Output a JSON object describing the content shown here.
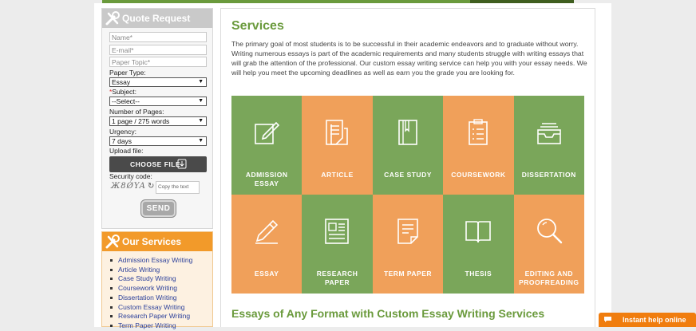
{
  "quote": {
    "title": "Quote Request",
    "name_ph": "Name*",
    "email_ph": "E-mail*",
    "topic_ph": "Paper Topic*",
    "paper_type_label": "Paper Type:",
    "paper_type_value": "Essay",
    "subject_label": "Subject:",
    "subject_value": "--Select--",
    "pages_label": "Number of Pages:",
    "pages_value": "1 page / 275 words",
    "urgency_label": "Urgency:",
    "urgency_value": "7 days",
    "upload_label": "Upload file:",
    "choose_label": "CHOOSE FILE",
    "security_label": "Security code:",
    "captcha_text": "Ж8ǾYA",
    "copy_ph": "Copy the text",
    "send_label": "SEND"
  },
  "our_services": {
    "title": "Our Services",
    "items": [
      "Admission Essay Writing",
      "Article Writing",
      "Case Study Writing",
      "Coursework Writing",
      "Dissertation Writing",
      "Custom Essay Writing",
      "Research Paper Writing",
      "Term Paper Writing"
    ]
  },
  "main": {
    "title": "Services",
    "intro": "The primary goal of most students is to be successful in their academic endeavors and to graduate without worry. Writing numerous essays is part of the academic requirements and many students struggle with writing essays that will grab the attention of the professional. Our custom essay writing service can help you with your essay needs. We will help you meet the upcoming deadlines as well as earn you the grade you are looking for.",
    "tiles": [
      {
        "label": "ADMISSION ESSAY",
        "icon": "edit-icon",
        "color": "#7aa65a"
      },
      {
        "label": "ARTICLE",
        "icon": "document-icon",
        "color": "#f0a05a"
      },
      {
        "label": "CASE STUDY",
        "icon": "book-icon",
        "color": "#7aa65a"
      },
      {
        "label": "COURSEWORK",
        "icon": "checklist-icon",
        "color": "#f0a05a"
      },
      {
        "label": "DISSERTATION",
        "icon": "tray-icon",
        "color": "#7aa65a"
      },
      {
        "label": "ESSAY",
        "icon": "pencil-icon",
        "color": "#f0a05a"
      },
      {
        "label": "RESEARCH PAPER",
        "icon": "newspaper-icon",
        "color": "#7aa65a"
      },
      {
        "label": "TERM PAPER",
        "icon": "page-icon",
        "color": "#f0a05a"
      },
      {
        "label": "THESIS",
        "icon": "open-book-icon",
        "color": "#7aa65a"
      },
      {
        "label": "EDITING AND PROOFREADING",
        "icon": "magnifier-icon",
        "color": "#f0a05a"
      }
    ],
    "subtitle": "Essays of Any Format with Custom Essay Writing Services"
  },
  "help": {
    "label": "Instant help online"
  }
}
